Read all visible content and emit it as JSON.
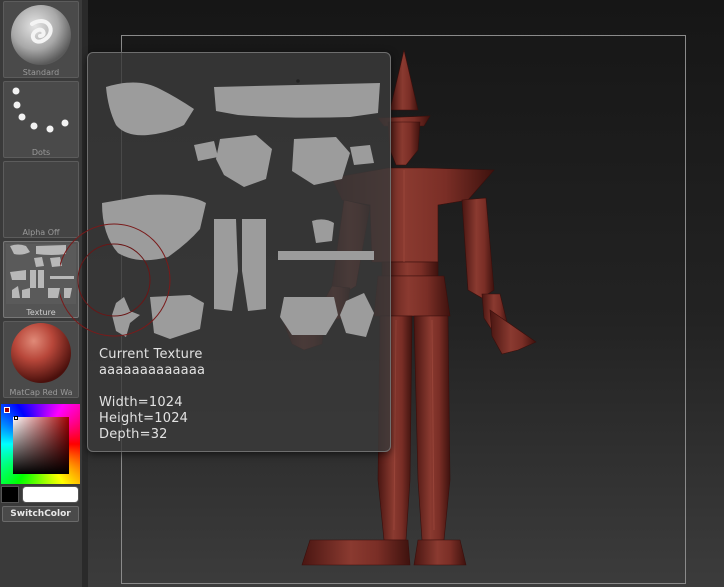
{
  "shelf": {
    "brush_label": "Standard",
    "stroke_label": "Dots",
    "alpha_label": "Alpha Off",
    "texture_label": "Texture",
    "material_label": "MatCap Red Wa",
    "switch_color_label": "SwitchColor"
  },
  "texture_popup": {
    "title": "Current Texture",
    "name": "aaaaaaaaaaaaa",
    "width": "Width=1024",
    "height": "Height=1024",
    "depth": "Depth=32"
  },
  "colors": {
    "main_color": "#a00000",
    "secondary_color": "#ffffff",
    "material_color": "#b8473a",
    "uv_island_color": "#9c9c9c"
  }
}
